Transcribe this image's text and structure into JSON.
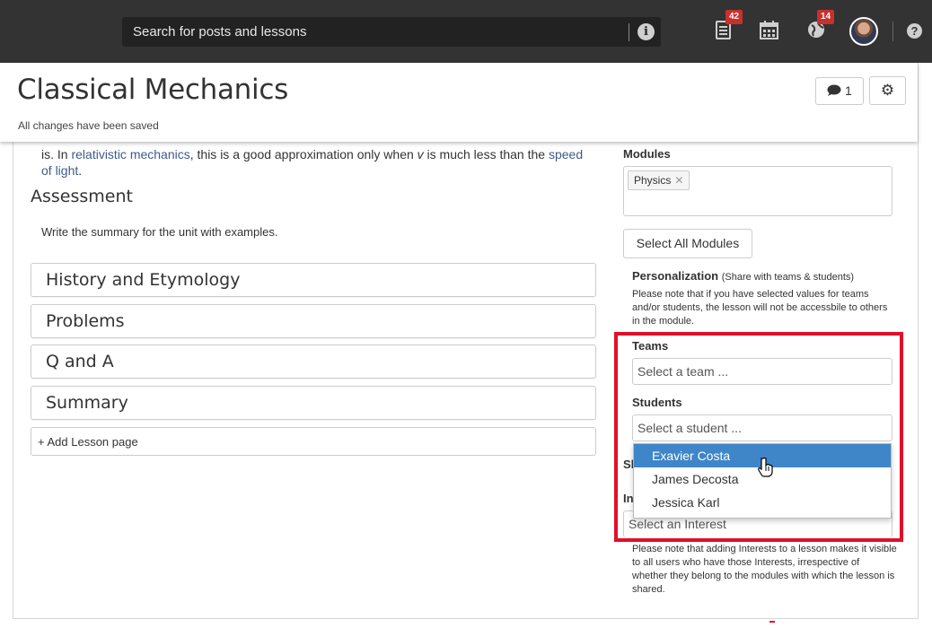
{
  "topbar": {
    "search_placeholder": "Search for posts and lessons",
    "notifications_count": "42",
    "global_count": "14"
  },
  "header": {
    "title": "Classical Mechanics",
    "save_status": "All changes have been saved",
    "comment_count": "1"
  },
  "content": {
    "intro_prefix": "is. In ",
    "intro_link1": "relativistic mechanics",
    "intro_mid": ", this is a good approximation only when ",
    "intro_var": "v",
    "intro_mid2": " is much less than the ",
    "intro_link2": "speed of light",
    "intro_end": ".",
    "assessment_title": "Assessment",
    "assessment_text": "Write the summary for the unit with examples.",
    "lesson_pages": [
      "History and Etymology",
      "Problems",
      "Q and A",
      "Summary"
    ],
    "add_page_label": "+ Add Lesson page"
  },
  "sidebar": {
    "modules_label": "Modules",
    "module_tag": "Physics",
    "select_all_label": "Select All Modules",
    "personalization_label": "Personalization",
    "personalization_sub": "(Share with teams & students)",
    "personalization_note": "Please note that if you have selected values for teams and/or students, the lesson will not be accessbile to others in the module.",
    "teams_label": "Teams",
    "teams_placeholder": "Select a team ...",
    "students_label": "Students",
    "students_placeholder": "Select a student ...",
    "student_options": [
      "Exavier Costa",
      "James Decosta",
      "Jessica Karl"
    ],
    "hidden_label_1": "Sh",
    "hidden_label_2": "In",
    "interest_placeholder": "Select an Interest",
    "interest_note": "Please note that adding Interests to a lesson makes it visible to all users who have those Interests, irrespective of whether they belong to the modules with which the lesson is shared."
  },
  "colors": {
    "topbar_bg": "#333333",
    "badge": "#c9302c",
    "highlight": "#e0102a",
    "dropdown_active": "#3f86c8",
    "link": "#3f5a8a"
  }
}
